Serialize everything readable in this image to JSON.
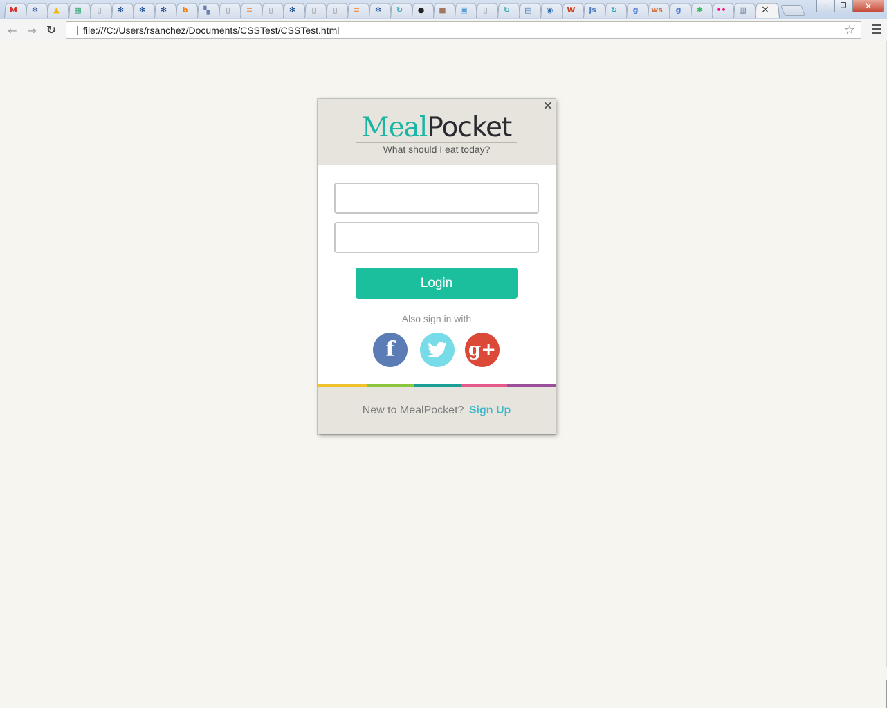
{
  "browser": {
    "tabs": [
      {
        "icon": "gmail-icon",
        "glyph": "M",
        "color": "#d93025"
      },
      {
        "icon": "confluence-icon",
        "glyph": "✻",
        "color": "#1d4f91"
      },
      {
        "icon": "drive-icon",
        "glyph": "▲",
        "color": "#f4b400"
      },
      {
        "icon": "sheets-icon",
        "glyph": "▦",
        "color": "#0f9d58"
      },
      {
        "icon": "page-icon",
        "glyph": "▯",
        "color": "#888888"
      },
      {
        "icon": "confluence-icon",
        "glyph": "✻",
        "color": "#1d4f91"
      },
      {
        "icon": "confluence-icon",
        "glyph": "✻",
        "color": "#1d4f91"
      },
      {
        "icon": "confluence-icon",
        "glyph": "✻",
        "color": "#1d4f91"
      },
      {
        "icon": "blogger-icon",
        "glyph": "b",
        "color": "#f57d00"
      },
      {
        "icon": "grid-icon",
        "glyph": "▚",
        "color": "#6b7fa8"
      },
      {
        "icon": "page-icon",
        "glyph": "▯",
        "color": "#888888"
      },
      {
        "icon": "stackoverflow-icon",
        "glyph": "≡",
        "color": "#f48024"
      },
      {
        "icon": "page-icon",
        "glyph": "▯",
        "color": "#888888"
      },
      {
        "icon": "confluence-icon",
        "glyph": "✻",
        "color": "#1d4f91"
      },
      {
        "icon": "page-icon",
        "glyph": "▯",
        "color": "#888888"
      },
      {
        "icon": "page-icon",
        "glyph": "▯",
        "color": "#888888"
      },
      {
        "icon": "stackoverflow-icon",
        "glyph": "≡",
        "color": "#f48024"
      },
      {
        "icon": "confluence-icon",
        "glyph": "✻",
        "color": "#1d4f91"
      },
      {
        "icon": "refresh-icon",
        "glyph": "↻",
        "color": "#2aa7b8"
      },
      {
        "icon": "github-icon",
        "glyph": "●",
        "color": "#222222"
      },
      {
        "icon": "photo-icon",
        "glyph": "■",
        "color": "#a07860"
      },
      {
        "icon": "window-icon",
        "glyph": "▣",
        "color": "#5aa0d8"
      },
      {
        "icon": "page-icon",
        "glyph": "▯",
        "color": "#888888"
      },
      {
        "icon": "refresh-icon",
        "glyph": "↻",
        "color": "#2aa7b8"
      },
      {
        "icon": "chart-icon",
        "glyph": "▤",
        "color": "#2e6fb2"
      },
      {
        "icon": "tripadvisor-icon",
        "glyph": "◉",
        "color": "#2a6db0"
      },
      {
        "icon": "wr-icon",
        "glyph": "W",
        "color": "#d04020"
      },
      {
        "icon": "jsfiddle-icon",
        "glyph": "js",
        "color": "#4679bd"
      },
      {
        "icon": "refresh-icon",
        "glyph": "↻",
        "color": "#2aa7b8"
      },
      {
        "icon": "google-icon",
        "glyph": "g",
        "color": "#4a7bd4"
      },
      {
        "icon": "w3schools-icon",
        "glyph": "ws",
        "color": "#d06a30"
      },
      {
        "icon": "google-icon",
        "glyph": "g",
        "color": "#4a7bd4"
      },
      {
        "icon": "evernote-icon",
        "glyph": "✱",
        "color": "#2dbe60"
      },
      {
        "icon": "flickr-icon",
        "glyph": "••",
        "color": "#ff0084"
      },
      {
        "icon": "stripes-icon",
        "glyph": "▥",
        "color": "#4a5a8a"
      },
      {
        "icon": "close-icon",
        "glyph": "×",
        "color": "#333333"
      }
    ],
    "window": {
      "minimize": "–",
      "restore": "❐",
      "close": "✕"
    },
    "nav": {
      "back": "←",
      "forward": "→",
      "reload": "↻",
      "star": "☆"
    },
    "address": "file:///C:/Users/rsanchez/Documents/CSSTest/CSSTest.html"
  },
  "modal": {
    "close": "×",
    "brand": {
      "part1": "Meal",
      "part2": "Pocket"
    },
    "tagline": "What should I eat today?",
    "fields": {
      "username_value": "",
      "password_value": ""
    },
    "login_label": "Login",
    "also_label": "Also sign in with",
    "social": [
      {
        "name": "facebook",
        "glyph": "f",
        "color": "#5c7cb6"
      },
      {
        "name": "twitter",
        "glyph": "🐦",
        "color": "#77dbe8"
      },
      {
        "name": "google-plus",
        "glyph": "g+",
        "color": "#db4a39"
      }
    ],
    "stripe_colors": [
      "#f0c22b",
      "#8cc63f",
      "#1a9e96",
      "#e4588a",
      "#9b4e9c"
    ],
    "footer": {
      "prompt": "New to MealPocket?",
      "signup": "Sign Up"
    }
  }
}
